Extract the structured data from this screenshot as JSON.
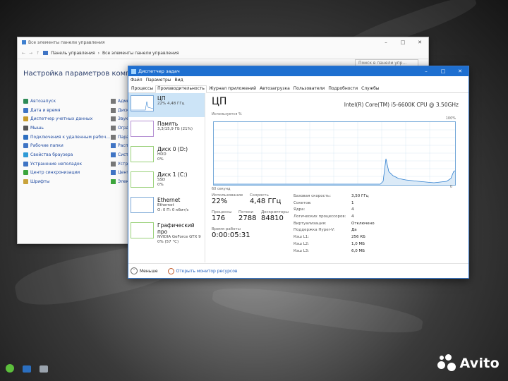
{
  "control_panel": {
    "title": "Все элементы панели управления",
    "breadcrumb": [
      "Панель управления",
      "Все элементы панели управления"
    ],
    "search_placeholder": "Поиск в панели упр...",
    "heading": "Настройка параметров компьютера",
    "items_left": [
      {
        "label": "Автозапуск",
        "color": "#2e8b57"
      },
      {
        "label": "Дата и время",
        "color": "#3f74c4"
      },
      {
        "label": "Диспетчер учетных данных",
        "color": "#c89b2a"
      },
      {
        "label": "Мышь",
        "color": "#555555"
      },
      {
        "label": "Подключения к удаленным рабоч...",
        "color": "#2e6fc0"
      },
      {
        "label": "Рабочие папки",
        "color": "#3f74c4"
      },
      {
        "label": "Свойства браузера",
        "color": "#2f9ad6"
      },
      {
        "label": "Устранение неполадок",
        "color": "#3f74c4"
      },
      {
        "label": "Центр синхронизации",
        "color": "#3ca53c"
      },
      {
        "label": "Шрифты",
        "color": "#c8a23a"
      }
    ],
    "items_right": [
      {
        "label": "Адми",
        "color": "#777777"
      },
      {
        "label": "Диск",
        "color": "#777777"
      },
      {
        "label": "Звук",
        "color": "#777777"
      },
      {
        "label": "Огра",
        "color": "#777777"
      },
      {
        "label": "Пара",
        "color": "#777777"
      },
      {
        "label": "Расп",
        "color": "#3f74c4"
      },
      {
        "label": "Систе",
        "color": "#3f74c4"
      },
      {
        "label": "Устр",
        "color": "#777777"
      },
      {
        "label": "Центр",
        "color": "#3f74c4"
      },
      {
        "label": "Элект",
        "color": "#3ca53c"
      }
    ]
  },
  "task_manager": {
    "title": "Диспетчер задач",
    "menu": [
      "Файл",
      "Параметры",
      "Вид"
    ],
    "tabs": [
      "Процессы",
      "Производительность",
      "Журнал приложений",
      "Автозагрузка",
      "Пользователи",
      "Подробности",
      "Службы"
    ],
    "active_tab": "Производительность",
    "devices": [
      {
        "title": "ЦП",
        "sub1": "22% 4,48 ГГц",
        "sub2": "",
        "kind": "cpu"
      },
      {
        "title": "Память",
        "sub1": "3,3/15,9 ГБ (21%)",
        "sub2": "",
        "kind": "mem"
      },
      {
        "title": "Диск 0 (D:)",
        "sub1": "HDD",
        "sub2": "0%",
        "kind": "disk"
      },
      {
        "title": "Диск 1 (C:)",
        "sub1": "SSD",
        "sub2": "0%",
        "kind": "disk"
      },
      {
        "title": "Ethernet",
        "sub1": "Ethernet",
        "sub2": "О: 0 П: 0 кбит/с",
        "kind": "net"
      },
      {
        "title": "Графический про",
        "sub1": "NVIDIA GeForce GTX 9",
        "sub2": "0% (57 °C)",
        "kind": "gpu"
      }
    ],
    "cpu": {
      "heading": "ЦП",
      "model": "Intel(R) Core(TM) i5-6600K CPU @ 3.50GHz",
      "graph_label": "Используется %",
      "graph_max": "100%",
      "graph_span": "60 секунд",
      "graph_min": "0",
      "usage_label": "Использование",
      "usage": "22%",
      "speed_label": "Скорость",
      "speed": "4,48 ГГц",
      "processes_label": "Процессы",
      "processes": "176",
      "threads_label": "Потоки",
      "threads": "2788",
      "handles_label": "Дескрипторы",
      "handles": "84810",
      "uptime_label": "Время работы",
      "uptime": "0:00:05:31",
      "props": [
        {
          "k": "Базовая скорость:",
          "v": "3,50 ГГц"
        },
        {
          "k": "Сокетов:",
          "v": "1"
        },
        {
          "k": "Ядра:",
          "v": "4"
        },
        {
          "k": "Логических процессоров:",
          "v": "4"
        },
        {
          "k": "Виртуализация:",
          "v": "Отключено"
        },
        {
          "k": "Поддержка Hyper-V:",
          "v": "Да"
        },
        {
          "k": "Кэш L1:",
          "v": "256 КБ"
        },
        {
          "k": "Кэш L2:",
          "v": "1,0 МБ"
        },
        {
          "k": "Кэш L3:",
          "v": "6,0 МБ"
        }
      ]
    },
    "footer": {
      "less": "Меньше",
      "monitor": "Открыть монитор ресурсов"
    }
  },
  "watermark": "Avito"
}
